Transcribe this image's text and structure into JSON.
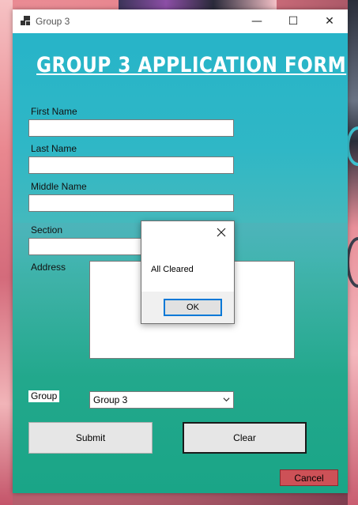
{
  "window": {
    "title": "Group 3",
    "controls": {
      "minimize": "—",
      "maximize": "☐",
      "close": "✕"
    }
  },
  "form": {
    "heading": "GROUP 3 APPLICATION FORM",
    "fields": {
      "first_name": {
        "label": "First Name",
        "value": ""
      },
      "last_name": {
        "label": "Last Name",
        "value": ""
      },
      "middle_name": {
        "label": "Middle Name",
        "value": ""
      },
      "section": {
        "label": "Section",
        "value": ""
      },
      "address": {
        "label": "Address",
        "value": ""
      }
    },
    "group": {
      "label": "Group",
      "selected": "Group 3"
    },
    "buttons": {
      "submit": "Submit",
      "clear": "Clear",
      "cancel": "Cancel"
    },
    "colors": {
      "accent_bg": "#27b4c8",
      "cancel_bg": "#cd5157",
      "focus_border": "#0078d7"
    }
  },
  "dialog": {
    "message": "All Cleared",
    "ok_label": "OK",
    "close_icon": "close-icon"
  }
}
